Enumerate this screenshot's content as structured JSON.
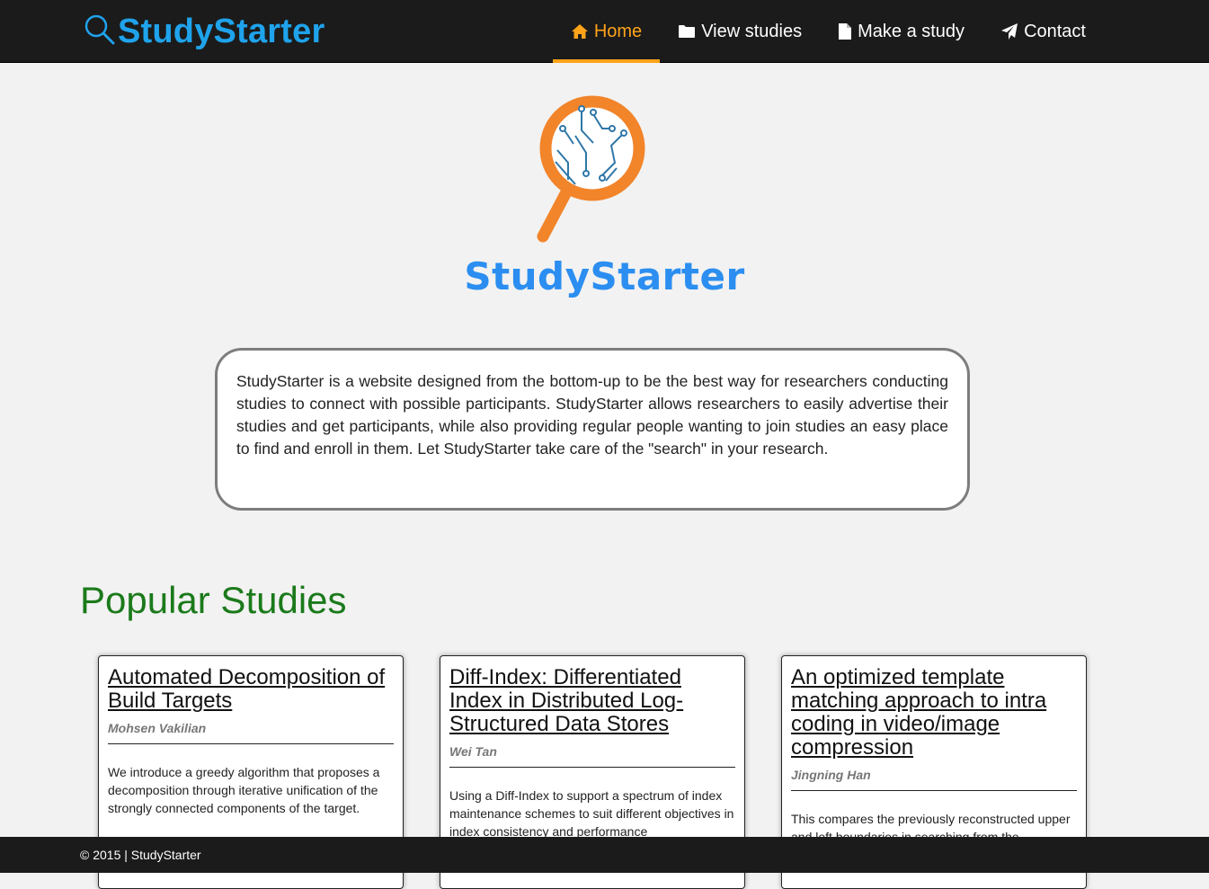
{
  "brand": {
    "name": "StudyStarter",
    "icon": "magnifier-icon",
    "color": "#1fa3ec"
  },
  "nav": {
    "items": [
      {
        "label": "Home",
        "icon": "home-icon",
        "active": true
      },
      {
        "label": "View studies",
        "icon": "folder-icon",
        "active": false
      },
      {
        "label": "Make a study",
        "icon": "document-icon",
        "active": false
      },
      {
        "label": "Contact",
        "icon": "paper-plane-icon",
        "active": false
      }
    ],
    "active_color": "#ffa31a"
  },
  "hero": {
    "title": "StudyStarter",
    "logo_icon": "magnifier-circuit-logo"
  },
  "about": {
    "text": "StudyStarter is a website designed from the bottom-up to be the best way for researchers conducting studies to connect with possible participants. StudyStarter allows researchers to easily advertise their studies and get participants, while also providing regular people wanting to join studies an easy place to find and enroll in them. Let StudyStarter take care of the \"search\" in your research."
  },
  "popular": {
    "title": "Popular Studies",
    "studies": [
      {
        "title": "Automated Decomposition of Build Targets",
        "author": "Mohsen Vakilian",
        "description": "We introduce a greedy algorithm that proposes a decomposition through iterative unification of the strongly connected components of the target."
      },
      {
        "title": "Diff-Index: Differentiated Index in Distributed Log-Structured Data Stores",
        "author": "Wei Tan",
        "description": "Using a Diff-Index to support a spectrum of index maintenance schemes to suit different objectives in index consistency and performance"
      },
      {
        "title": "An optimized template matching approach to intra coding in video/image compression",
        "author": "Jingning Han",
        "description": "This compares the previously reconstructed upper and left boundaries in searching from the"
      }
    ]
  },
  "footer": {
    "text": "© 2015 | StudyStarter"
  }
}
